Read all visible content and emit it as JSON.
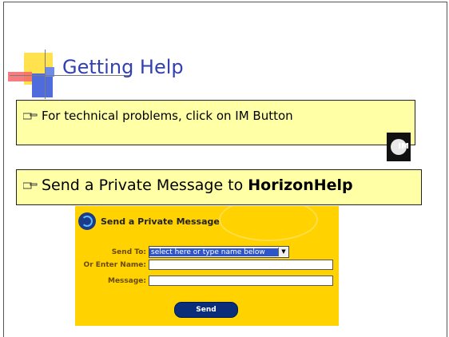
{
  "slide": {
    "title": "Getting Help"
  },
  "bullets": [
    {
      "text": "For technical problems, click on IM Button"
    },
    {
      "text_prefix": "Send a Private Message to",
      "text_bold": "HorizonHelp"
    }
  ],
  "im_button": {
    "label": "IM"
  },
  "private_message_form": {
    "header": "Send a Private Message",
    "send_to_label": "Send To:",
    "send_to_selected": "select here or type name below",
    "or_enter_name_label": "Or Enter Name:",
    "or_enter_name_value": "",
    "message_label": "Message:",
    "message_value": "",
    "send_button": "Send"
  },
  "colors": {
    "title": "#3340b0",
    "bullet_box": "#ffffa6",
    "form_panel": "#ffd200",
    "send_button": "#0b2e7a"
  }
}
